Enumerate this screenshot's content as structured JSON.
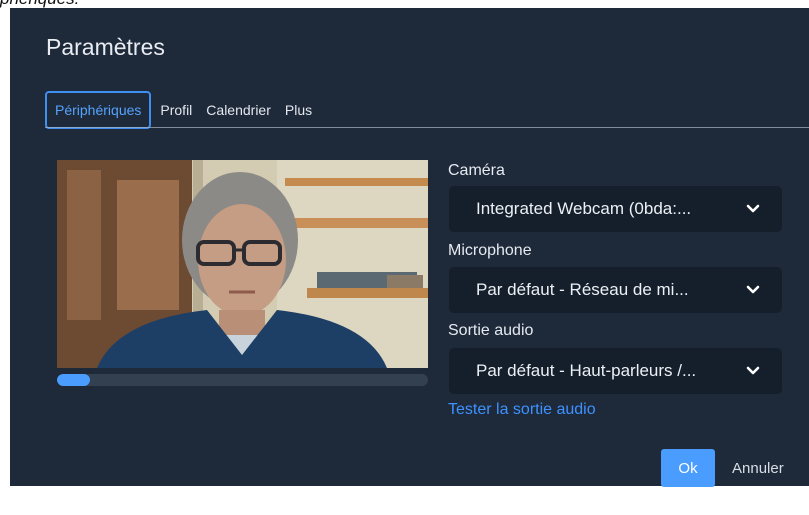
{
  "caption_fragment": "phériques.",
  "dialog": {
    "title": "Paramètres",
    "tabs": [
      {
        "label": "Périphériques",
        "active": true
      },
      {
        "label": "Profil",
        "active": false
      },
      {
        "label": "Calendrier",
        "active": false
      },
      {
        "label": "Plus",
        "active": false
      }
    ]
  },
  "preview": {
    "audio_level_fraction": 0.09
  },
  "fields": {
    "camera": {
      "label": "Caméra",
      "value": "Integrated Webcam (0bda:..."
    },
    "microphone": {
      "label": "Microphone",
      "value": "Par défaut - Réseau de mi..."
    },
    "audio_output": {
      "label": "Sortie audio",
      "value": "Par défaut - Haut-parleurs /..."
    }
  },
  "test_audio_link": "Tester la sortie audio",
  "buttons": {
    "ok": "Ok",
    "cancel": "Annuler"
  },
  "colors": {
    "dialog_bg": "#1e2939",
    "select_bg": "#151f2c",
    "accent": "#4a9cff",
    "link": "#3d92ff"
  },
  "icons": {
    "select_chevron": "chevron-down-icon"
  }
}
